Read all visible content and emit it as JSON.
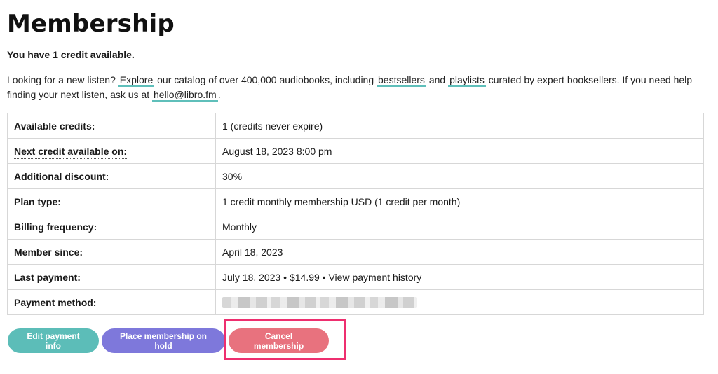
{
  "page": {
    "title": "Membership",
    "credits_line": "You have 1 credit available."
  },
  "intro": {
    "part1": "Looking for a new listen?",
    "explore_link": "Explore",
    "part2": "our catalog of over 400,000 audiobooks, including",
    "bestsellers_link": "bestsellers",
    "part3": "and",
    "playlists_link": "playlists",
    "part4": "curated by expert booksellers. If you need help finding your next listen, ask us at",
    "email_link": "hello@libro.fm",
    "part5": "."
  },
  "details": {
    "rows": [
      {
        "label": "Available credits:",
        "value": "1 (credits never expire)"
      },
      {
        "label": "Next credit available on:",
        "value": "August 18, 2023 8:00 pm"
      },
      {
        "label": "Additional discount:",
        "value": "30%"
      },
      {
        "label": "Plan type:",
        "value": "1 credit monthly membership USD (1 credit per month)"
      },
      {
        "label": "Billing frequency:",
        "value": "Monthly"
      },
      {
        "label": "Member since:",
        "value": "April 18, 2023"
      },
      {
        "label": "Last payment:",
        "value": "July 18, 2023 • $14.99 •",
        "link": "View payment history"
      },
      {
        "label": "Payment method:",
        "value": ""
      }
    ]
  },
  "buttons": {
    "edit_payment": "Edit payment info",
    "hold": "Place membership on hold",
    "cancel": "Cancel membership"
  },
  "colors": {
    "teal": "#5cbdb8",
    "purple": "#7e78db",
    "pink": "#e8727e",
    "highlight": "#ee2f6f"
  }
}
